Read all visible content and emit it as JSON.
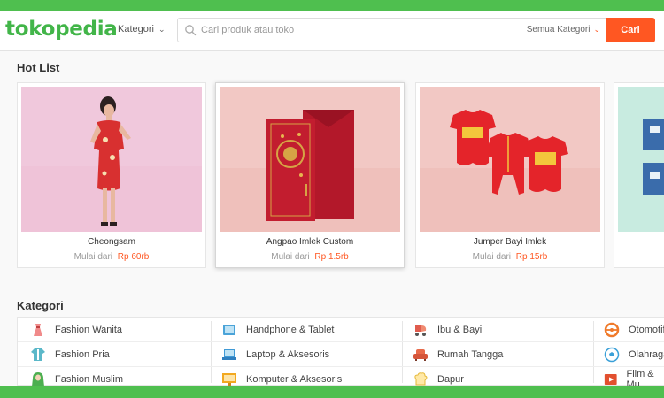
{
  "header": {
    "logo": "tokopedia",
    "kategori_label": "Kategori",
    "search_placeholder": "Cari produk atau toko",
    "search_value": "",
    "category_select": "Semua Kategori",
    "cari_label": "Cari"
  },
  "hot_list": {
    "title": "Hot List",
    "items": [
      {
        "name": "Cheongsam",
        "price_prefix": "Mulai dari",
        "price": "Rp 60rb"
      },
      {
        "name": "Angpao Imlek Custom",
        "price_prefix": "Mulai dari",
        "price": "Rp 1.5rb"
      },
      {
        "name": "Jumper Bayi Imlek",
        "price_prefix": "Mulai dari",
        "price": "Rp 15rb"
      }
    ]
  },
  "kategori": {
    "title": "Kategori",
    "rows": [
      [
        "Fashion Wanita",
        "Handphone & Tablet",
        "Ibu & Bayi",
        "Otomotif"
      ],
      [
        "Fashion Pria",
        "Laptop & Aksesoris",
        "Rumah Tangga",
        "Olahraga"
      ],
      [
        "Fashion Muslim",
        "Komputer & Aksesoris",
        "Dapur",
        "Film & Mu"
      ]
    ]
  },
  "colors": {
    "brand_green": "#42b549",
    "accent_orange": "#ff5722",
    "frame_green": "#4fbf4f"
  }
}
